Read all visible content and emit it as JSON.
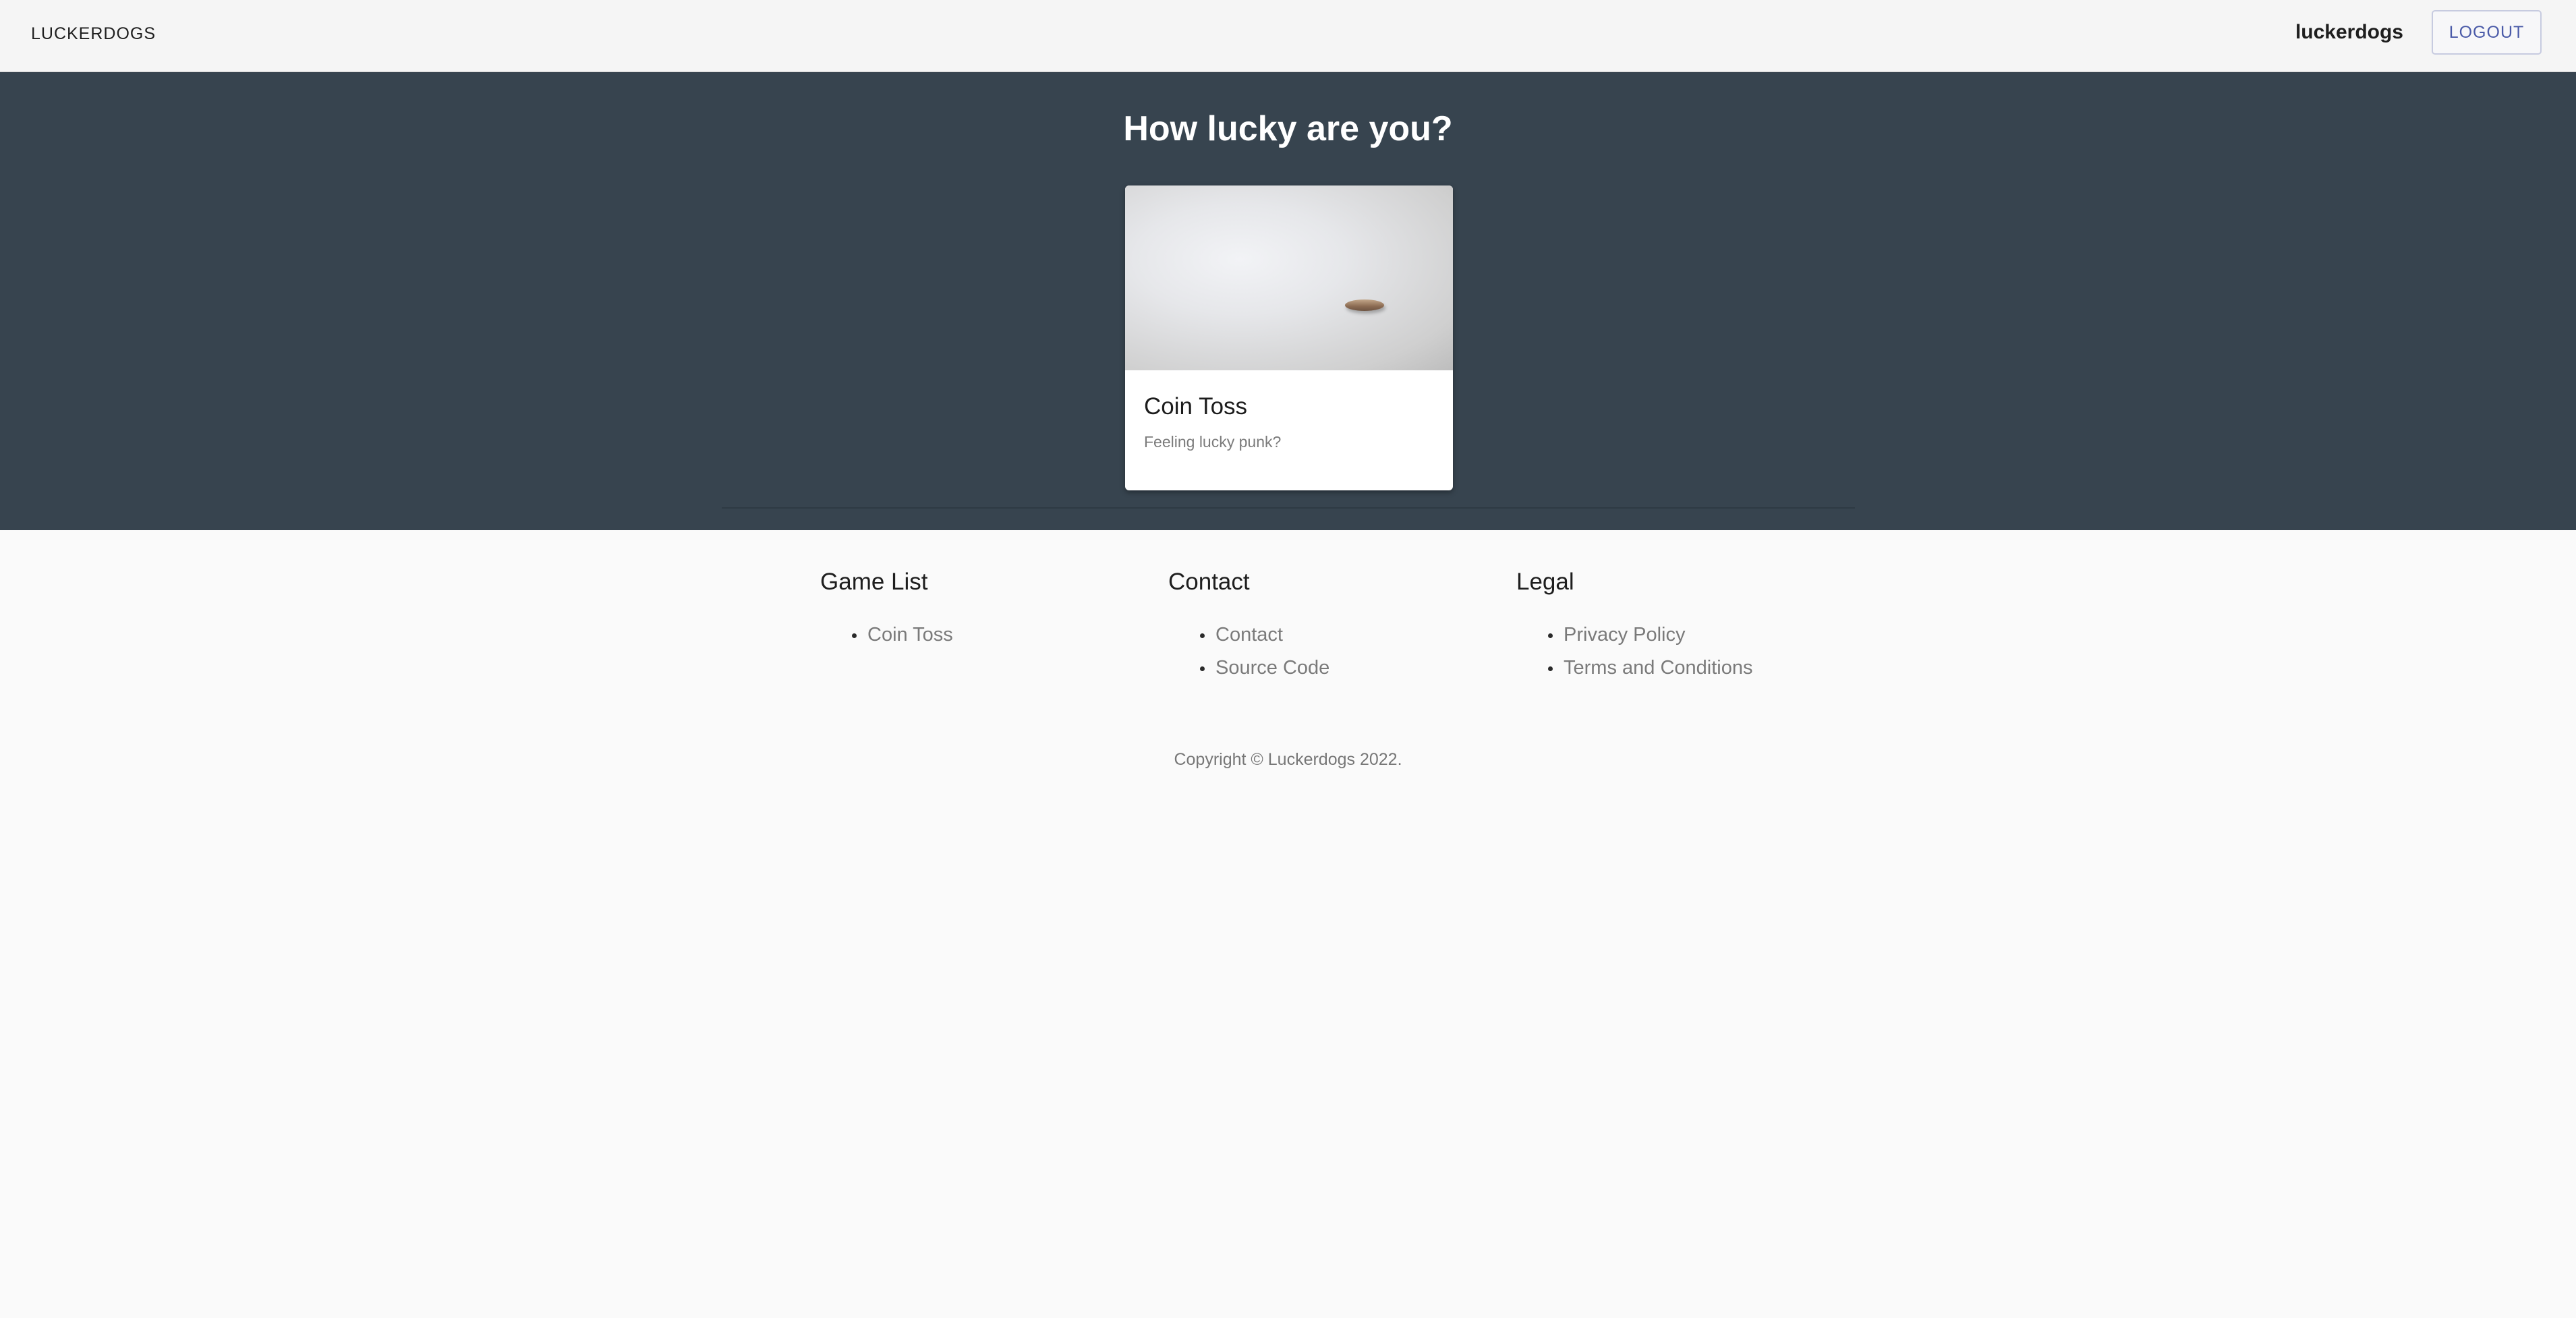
{
  "navbar": {
    "brand": "LUCKERDOGS",
    "username": "luckerdogs",
    "logout_label": "LOGOUT"
  },
  "hero": {
    "title": "How lucky are you?",
    "games": [
      {
        "title": "Coin Toss",
        "subtitle": "Feeling lucky punk?",
        "image": "coin-toss-photo"
      }
    ]
  },
  "footer": {
    "game_list": {
      "heading": "Game List",
      "links": [
        "Coin Toss"
      ]
    },
    "contact": {
      "heading": "Contact",
      "links": [
        "Contact",
        "Source Code"
      ]
    },
    "legal": {
      "heading": "Legal",
      "links": [
        "Privacy Policy",
        "Terms and Conditions"
      ]
    },
    "copyright": "Copyright © Luckerdogs 2022."
  },
  "colors": {
    "hero_bg": "#37444f",
    "navbar_bg": "#f5f5f5",
    "page_bg": "#fafafa",
    "logout_text": "#4a5aa8"
  }
}
